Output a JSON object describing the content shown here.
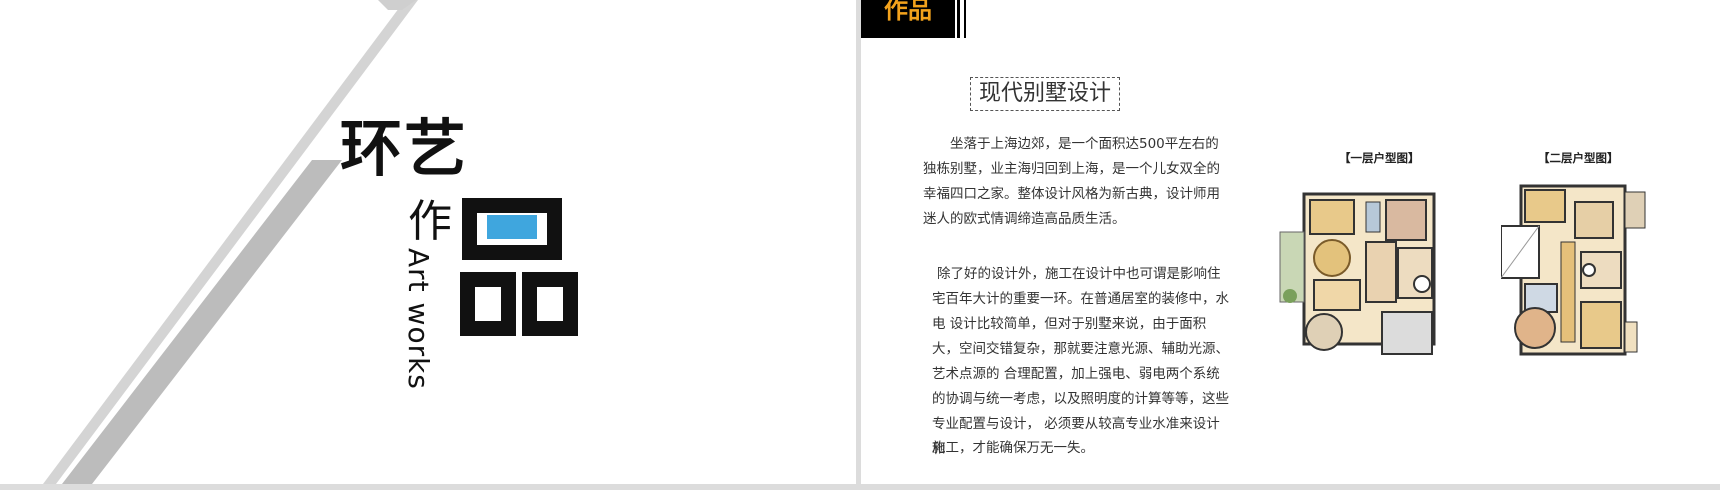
{
  "left_slide": {
    "title_line1": "环艺",
    "title_zuo": "作",
    "title_pin": "品",
    "subtitle": "Art works",
    "accent_color": "#3fa6de"
  },
  "right_slide": {
    "tag": "作品",
    "tag_color": "#f3a21c",
    "section_title": "现代别墅设计",
    "paragraph1": "坐落于上海边郊，是一个面积达500平左右的独栋别墅，业主海归回到上海，是一个儿女双全的幸福四口之家。整体设计风格为新古典，设计师用迷人的欧式情调缔造高品质生活。",
    "paragraph2": "除了好的设计外，施工在设计中也可谓是影响住宅百年大计的重要一环。在普通居室的装修中，水电 设计比较简单，但对于别墅来说，由于面积大，空间交错复杂，那就要注意光源、辅助光源、艺术点源的 合理配置，加上强电、弱电两个系统的协调与统一考虑，以及照明度的计算等等，这些专业配置与设计， 必须要从较高专业水准来设计和",
    "paragraph2_end": "施工，才能确保万无一失。",
    "plan1_label": "【一层户型图】",
    "plan2_label": "【二层户型图】"
  }
}
